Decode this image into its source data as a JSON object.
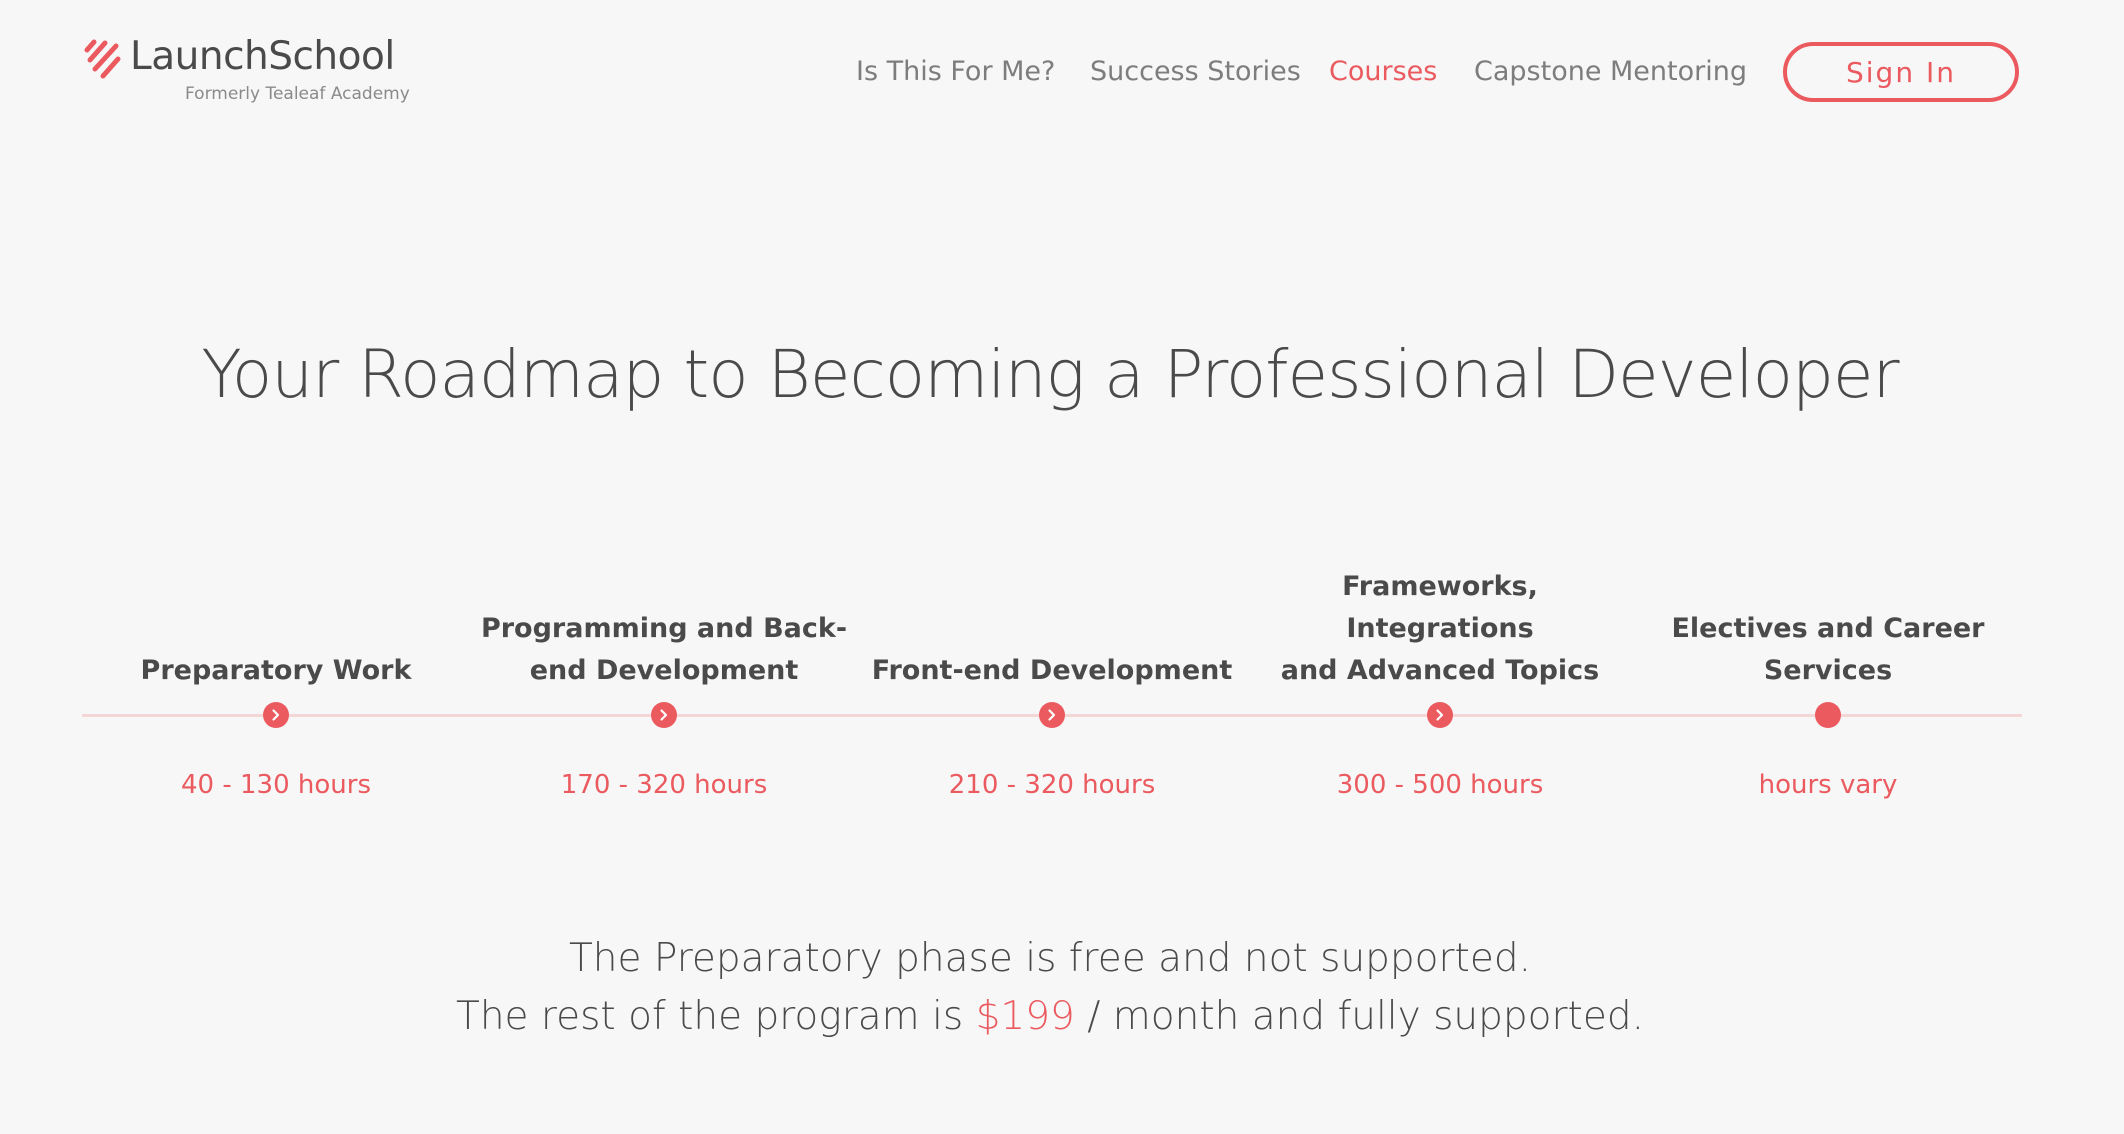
{
  "brand": {
    "name": "LaunchSchool",
    "subtitle": "Formerly Tealeaf Academy",
    "accent_color": "#ea5a5f"
  },
  "nav": {
    "items": [
      {
        "label": "Is This For Me?",
        "active": false
      },
      {
        "label": "Success Stories",
        "active": false
      },
      {
        "label": "Courses",
        "active": true
      },
      {
        "label": "Capstone Mentoring",
        "active": false
      }
    ],
    "signin_label": "Sign In"
  },
  "hero": {
    "title": "Your Roadmap to Becoming a Professional Developer"
  },
  "roadmap": {
    "stages": [
      {
        "title": "Preparatory Work",
        "hours": "40 - 130 hours",
        "icon": "chevron-right-icon"
      },
      {
        "title": "Programming and Back-end Development",
        "title_lines": [
          "Programming and Back-",
          "end Development"
        ],
        "hours": "170 - 320 hours",
        "icon": "chevron-right-icon"
      },
      {
        "title": "Front-end Development",
        "hours": "210 - 320 hours",
        "icon": "chevron-right-icon"
      },
      {
        "title": "Frameworks, Integrations and Advanced Topics",
        "title_lines": [
          "Frameworks, Integrations",
          "and Advanced Topics"
        ],
        "hours": "300 - 500 hours",
        "icon": "chevron-right-icon"
      },
      {
        "title": "Electives and Career Services",
        "title_lines": [
          "Electives and Career",
          "Services"
        ],
        "hours": "hours vary",
        "icon": "dot"
      }
    ]
  },
  "pricing": {
    "line1": "The Preparatory phase is free and not supported.",
    "line2_prefix": "The rest of the program is ",
    "price": "$199",
    "line2_suffix": " / month and fully supported."
  }
}
